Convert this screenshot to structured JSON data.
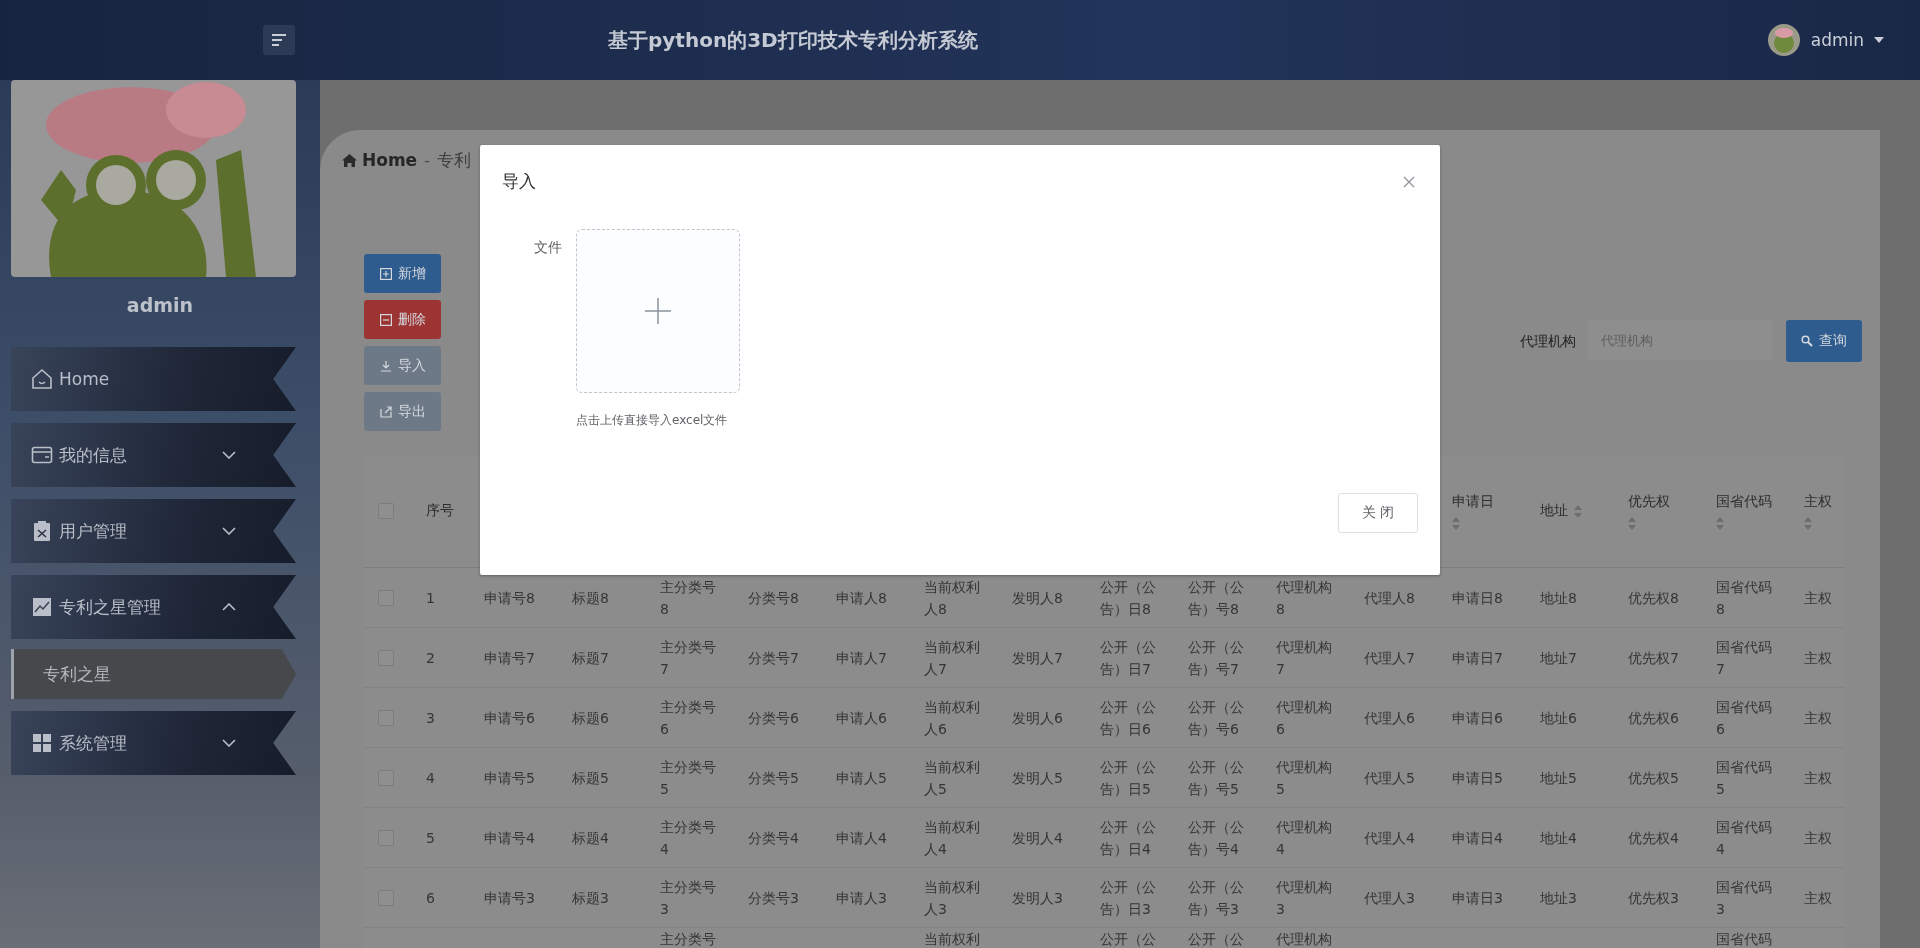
{
  "header": {
    "title": "基于python的3D打印技术专利分析系统",
    "user": "admin"
  },
  "sidebar": {
    "username": "admin",
    "menu": [
      {
        "label": "Home",
        "expandable": false
      },
      {
        "label": "我的信息",
        "expandable": true,
        "expanded": false
      },
      {
        "label": "用户管理",
        "expandable": true,
        "expanded": false
      },
      {
        "label": "专利之星管理",
        "expandable": true,
        "expanded": true,
        "children": [
          {
            "label": "专利之星",
            "selected": true
          }
        ]
      },
      {
        "label": "系统管理",
        "expandable": true,
        "expanded": false
      }
    ]
  },
  "breadcrumb": {
    "items": [
      "Home",
      "专利"
    ],
    "separator": "-"
  },
  "toolbar_buttons": [
    {
      "label": "新增",
      "color": "#2f5c8e"
    },
    {
      "label": "删除",
      "color": "#9c3434"
    },
    {
      "label": "导入",
      "color": "#6d7987"
    },
    {
      "label": "导出",
      "color": "#6d7987"
    }
  ],
  "search": {
    "label": "代理机构",
    "placeholder": "代理机构",
    "button": "查询"
  },
  "table": {
    "header_checkbox": {
      "checked": false
    },
    "headers_left": [
      {
        "label": "序号",
        "sortable": false
      }
    ],
    "headers_right": [
      {
        "label": "申请日",
        "sortable": true
      },
      {
        "label": "地址",
        "sortable": true
      },
      {
        "label": "优先权",
        "sortable": true
      },
      {
        "label": "国省代码",
        "sortable": true
      },
      {
        "label": "主权",
        "sortable": true
      }
    ],
    "rows": [
      {
        "checked": false,
        "cells": [
          "1",
          "申请号8",
          "标题8",
          "主分类号8",
          "分类号8",
          "申请人8",
          "当前权利人8",
          "发明人8",
          "公开（公告）日8",
          "公开（公告）号8",
          "代理机构8",
          "代理人8",
          "申请日8",
          "地址8",
          "优先权8",
          "国省代码8",
          "主权"
        ]
      },
      {
        "checked": false,
        "cells": [
          "2",
          "申请号7",
          "标题7",
          "主分类号7",
          "分类号7",
          "申请人7",
          "当前权利人7",
          "发明人7",
          "公开（公告）日7",
          "公开（公告）号7",
          "代理机构7",
          "代理人7",
          "申请日7",
          "地址7",
          "优先权7",
          "国省代码7",
          "主权"
        ]
      },
      {
        "checked": false,
        "cells": [
          "3",
          "申请号6",
          "标题6",
          "主分类号6",
          "分类号6",
          "申请人6",
          "当前权利人6",
          "发明人6",
          "公开（公告）日6",
          "公开（公告）号6",
          "代理机构6",
          "代理人6",
          "申请日6",
          "地址6",
          "优先权6",
          "国省代码6",
          "主权"
        ]
      },
      {
        "checked": false,
        "cells": [
          "4",
          "申请号5",
          "标题5",
          "主分类号5",
          "分类号5",
          "申请人5",
          "当前权利人5",
          "发明人5",
          "公开（公告）日5",
          "公开（公告）号5",
          "代理机构5",
          "代理人5",
          "申请日5",
          "地址5",
          "优先权5",
          "国省代码5",
          "主权"
        ]
      },
      {
        "checked": false,
        "cells": [
          "5",
          "申请号4",
          "标题4",
          "主分类号4",
          "分类号4",
          "申请人4",
          "当前权利人4",
          "发明人4",
          "公开（公告）日4",
          "公开（公告）号4",
          "代理机构4",
          "代理人4",
          "申请日4",
          "地址4",
          "优先权4",
          "国省代码4",
          "主权"
        ]
      },
      {
        "checked": false,
        "cells": [
          "6",
          "申请号3",
          "标题3",
          "主分类号3",
          "分类号3",
          "申请人3",
          "当前权利人3",
          "发明人3",
          "公开（公告）日3",
          "公开（公告）号3",
          "代理机构3",
          "代理人3",
          "申请日3",
          "地址3",
          "优先权3",
          "国省代码3",
          "主权"
        ]
      }
    ],
    "partial_row": {
      "main_class": "主分类号",
      "current_owner": "当前权利",
      "publication_date": "公开（公",
      "publication_number": "公开（公",
      "agency": "代理机构",
      "province_code": "国省代码"
    }
  },
  "dialog": {
    "title": "导入",
    "field_label": "文件",
    "hint": "点击上传直接导入excel文件",
    "close_button": "关 闭"
  }
}
